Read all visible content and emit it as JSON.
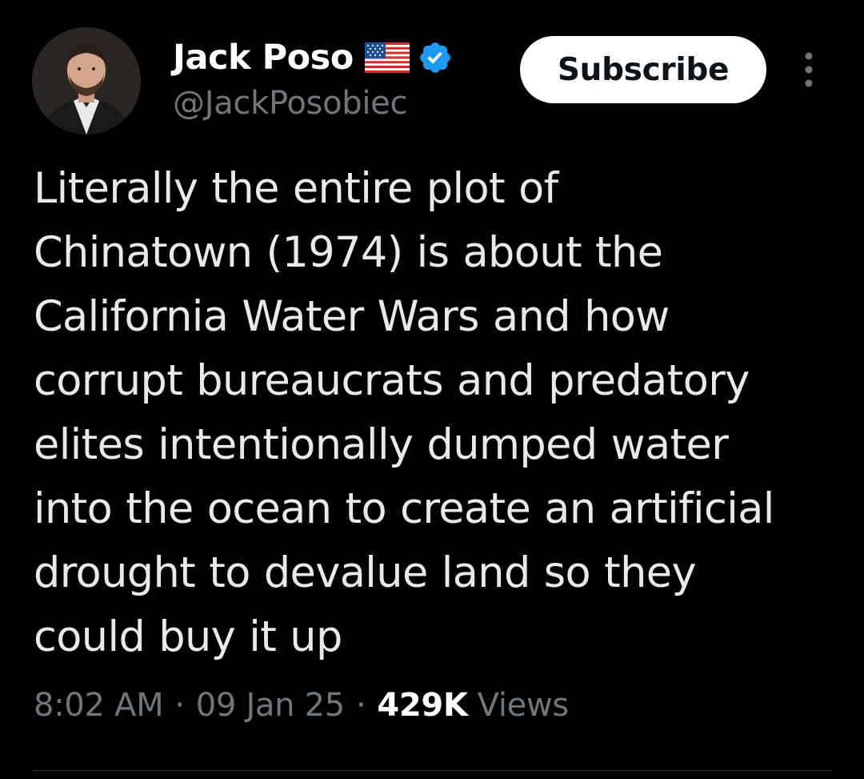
{
  "author": {
    "display_name": "Jack Poso",
    "handle": "@JackPosobiec",
    "flag_icon": "us-flag-icon",
    "verified_icon": "verified-badge-icon",
    "verified_color": "#1d9bf0"
  },
  "actions": {
    "subscribe_label": "Subscribe",
    "more_icon": "more-options-icon"
  },
  "tweet": {
    "lines": [
      "Literally the entire plot of",
      "Chinatown (1974) is about the",
      "California Water Wars and how",
      "corrupt bureaucrats and predatory",
      "elites intentionally dumped water",
      "into the ocean to create an artificial",
      "drought to devalue land so they",
      "could buy it up"
    ]
  },
  "meta": {
    "time": "8:02 AM",
    "separator": "·",
    "date": "09 Jan 25",
    "views_count": "429K",
    "views_label": "Views"
  },
  "colors": {
    "background": "#000000",
    "text_primary": "#e7e9ea",
    "text_secondary": "#71767b",
    "button_bg": "#ffffff"
  }
}
